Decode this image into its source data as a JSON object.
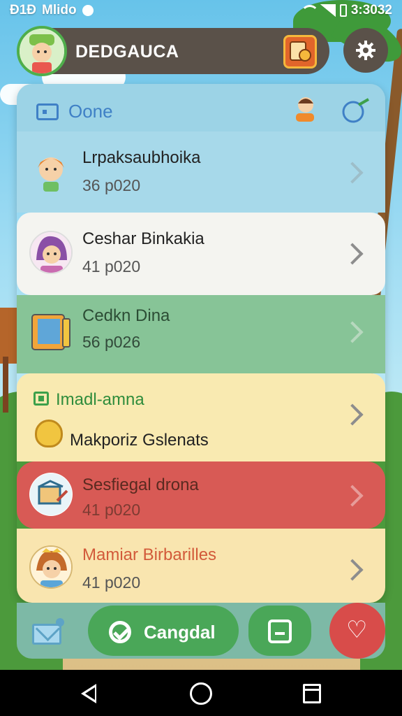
{
  "status_bar": {
    "left_text": "Mlido",
    "left_prefix": "Ð1Ð",
    "right_text": "3:3032"
  },
  "header": {
    "title": "DEDGAUCA",
    "avatar": "player-avatar",
    "badge_icon": "game-card-icon",
    "settings_icon": "gear-icon"
  },
  "section": {
    "title": "Oone",
    "icon": "ticket-icon",
    "mascot_icon": "character-icon",
    "extra_icon": "bubble-icon"
  },
  "rows": [
    {
      "title": "Lrpaksаubhoika",
      "sub": "36 p020",
      "icon": "girl-avatar-icon"
    },
    {
      "title": "Ceshar Binkakia",
      "sub": "41 p020",
      "icon": "woman-avatar-icon"
    },
    {
      "title": "Cedkn Dina",
      "sub": "56 p026",
      "icon": "tablet-icon"
    },
    {
      "tag": "Imadl-amna",
      "title": "Makporiz Gslenats",
      "icon": "hive-icon"
    },
    {
      "title": "Sesfiegal drona",
      "sub": "41 p020",
      "icon": "package-icon"
    },
    {
      "title": "Mamiar Birbarilles",
      "sub": "41 p020",
      "icon": "girl-avatar-icon"
    }
  ],
  "actions": {
    "confirm_label": "Cangdal",
    "mail_icon": "mail-icon",
    "note_icon": "note-icon",
    "fav_icon": "heart-icon"
  },
  "colors": {
    "header_bg": "#5a5149",
    "accent_green": "#4aa758",
    "accent_red": "#d84c4a",
    "section_blue": "#3f80c6"
  }
}
